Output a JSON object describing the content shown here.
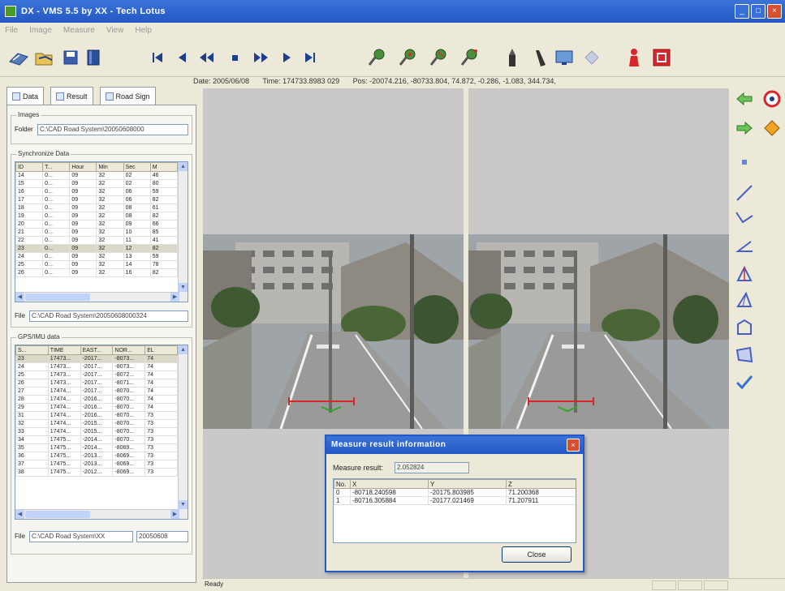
{
  "window": {
    "title": "DX - VMS 5.5 by XX - Tech Lotus",
    "btn_min": "_",
    "btn_max": "□",
    "btn_close": "×"
  },
  "menu": [
    "File",
    "Image",
    "Measure",
    "View",
    "Help"
  ],
  "toolbar": {
    "buttons": [
      "open-road-icon",
      "open-folder-icon",
      "save-icon",
      "book-icon",
      "first-icon",
      "prev-icon",
      "rewind-icon",
      "stop-icon",
      "fast-forward-icon",
      "next-icon",
      "last-icon",
      "pin-1-icon",
      "pin-2-icon",
      "pin-3-icon",
      "pin-4-icon",
      "tool-a-icon",
      "tool-b-icon",
      "display-icon",
      "diamond-icon",
      "person-icon",
      "exit-icon"
    ]
  },
  "info": {
    "date": "Date: 2005/06/08",
    "time": "Time: 174733.8983 029",
    "pos": "Pos: -20074.216, -80733.804, 74.872, -0.286, -1.083, 344.734,"
  },
  "tabs": {
    "data": "Data",
    "result": "Result",
    "roadsign": "Road Sign"
  },
  "images": {
    "group": "Images",
    "folder_label": "Folder",
    "folder_value": "C:\\CAD Road System\\20050608000"
  },
  "sync": {
    "group": "Synchronize Data",
    "columns": [
      "ID",
      "T...",
      "Hour",
      "Min",
      "Sec",
      "M"
    ],
    "rows": [
      [
        "14",
        "0...",
        "09",
        "32",
        "02",
        "46"
      ],
      [
        "15",
        "0...",
        "09",
        "32",
        "02",
        "80"
      ],
      [
        "16",
        "0...",
        "09",
        "32",
        "06",
        "59"
      ],
      [
        "17",
        "0...",
        "09",
        "32",
        "06",
        "82"
      ],
      [
        "18",
        "0...",
        "09",
        "32",
        "08",
        "61"
      ],
      [
        "19",
        "0...",
        "09",
        "32",
        "08",
        "82"
      ],
      [
        "20",
        "0...",
        "09",
        "32",
        "09",
        "66"
      ],
      [
        "21",
        "0...",
        "09",
        "32",
        "10",
        "85"
      ],
      [
        "22",
        "0...",
        "09",
        "32",
        "11",
        "41"
      ],
      [
        "23",
        "0...",
        "09",
        "32",
        "12",
        "82"
      ],
      [
        "24",
        "0...",
        "09",
        "32",
        "13",
        "59"
      ],
      [
        "25",
        "0...",
        "09",
        "32",
        "14",
        "78"
      ],
      [
        "26",
        "0...",
        "09",
        "32",
        "16",
        "82"
      ]
    ],
    "selected_index": 9,
    "file_label": "File",
    "file_value": "C:\\CAD Road System\\20050608000324"
  },
  "gps": {
    "group": "GPS/IMU data",
    "columns": [
      "S...",
      "TIME",
      "EAST...",
      "NOR...",
      "EL"
    ],
    "rows": [
      [
        "23",
        "17473...",
        "-2017...",
        "-8073...",
        "74"
      ],
      [
        "24",
        "17473...",
        "-2017...",
        "-8073...",
        "74"
      ],
      [
        "25",
        "17473...",
        "-2017...",
        "-8072...",
        "74"
      ],
      [
        "26",
        "17473...",
        "-2017...",
        "-8071...",
        "74"
      ],
      [
        "27",
        "17474...",
        "-2017...",
        "-8070...",
        "74"
      ],
      [
        "28",
        "17474...",
        "-2016...",
        "-8070...",
        "74"
      ],
      [
        "29",
        "17474...",
        "-2016...",
        "-8070...",
        "74"
      ],
      [
        "31",
        "17474...",
        "-2016...",
        "-8070...",
        "73"
      ],
      [
        "32",
        "17474...",
        "-2015...",
        "-8070...",
        "73"
      ],
      [
        "33",
        "17474...",
        "-2015...",
        "-8070...",
        "73"
      ],
      [
        "34",
        "17475...",
        "-2014...",
        "-8070...",
        "73"
      ],
      [
        "35",
        "17475...",
        "-2014...",
        "-8069...",
        "73"
      ],
      [
        "36",
        "17475...",
        "-2013...",
        "-8069...",
        "73"
      ],
      [
        "37",
        "17475...",
        "-2013...",
        "-8069...",
        "73"
      ],
      [
        "38",
        "17475...",
        "-2012...",
        "-8069...",
        "73"
      ]
    ],
    "selected_index": 0,
    "file_label": "File",
    "file_value": "C:\\CAD Road System\\XX",
    "file_value2": "20050608"
  },
  "dialog": {
    "title": "Measure result information",
    "result_label": "Measure result:",
    "result_value": "2.052824",
    "columns": [
      "No.",
      "X",
      "Y",
      "Z"
    ],
    "rows": [
      [
        "0",
        "-80718.240598",
        "-20175.803985",
        "71.200368"
      ],
      [
        "1",
        "-80716.305884",
        "-20177.021469",
        "71.207911"
      ]
    ],
    "close_label": "Close",
    "close_x": "×"
  },
  "status": {
    "text": "Ready"
  },
  "colors": {
    "titlebar": "#2458c4",
    "measure_line": "#d9262b",
    "green_arrow": "#33a52a"
  }
}
